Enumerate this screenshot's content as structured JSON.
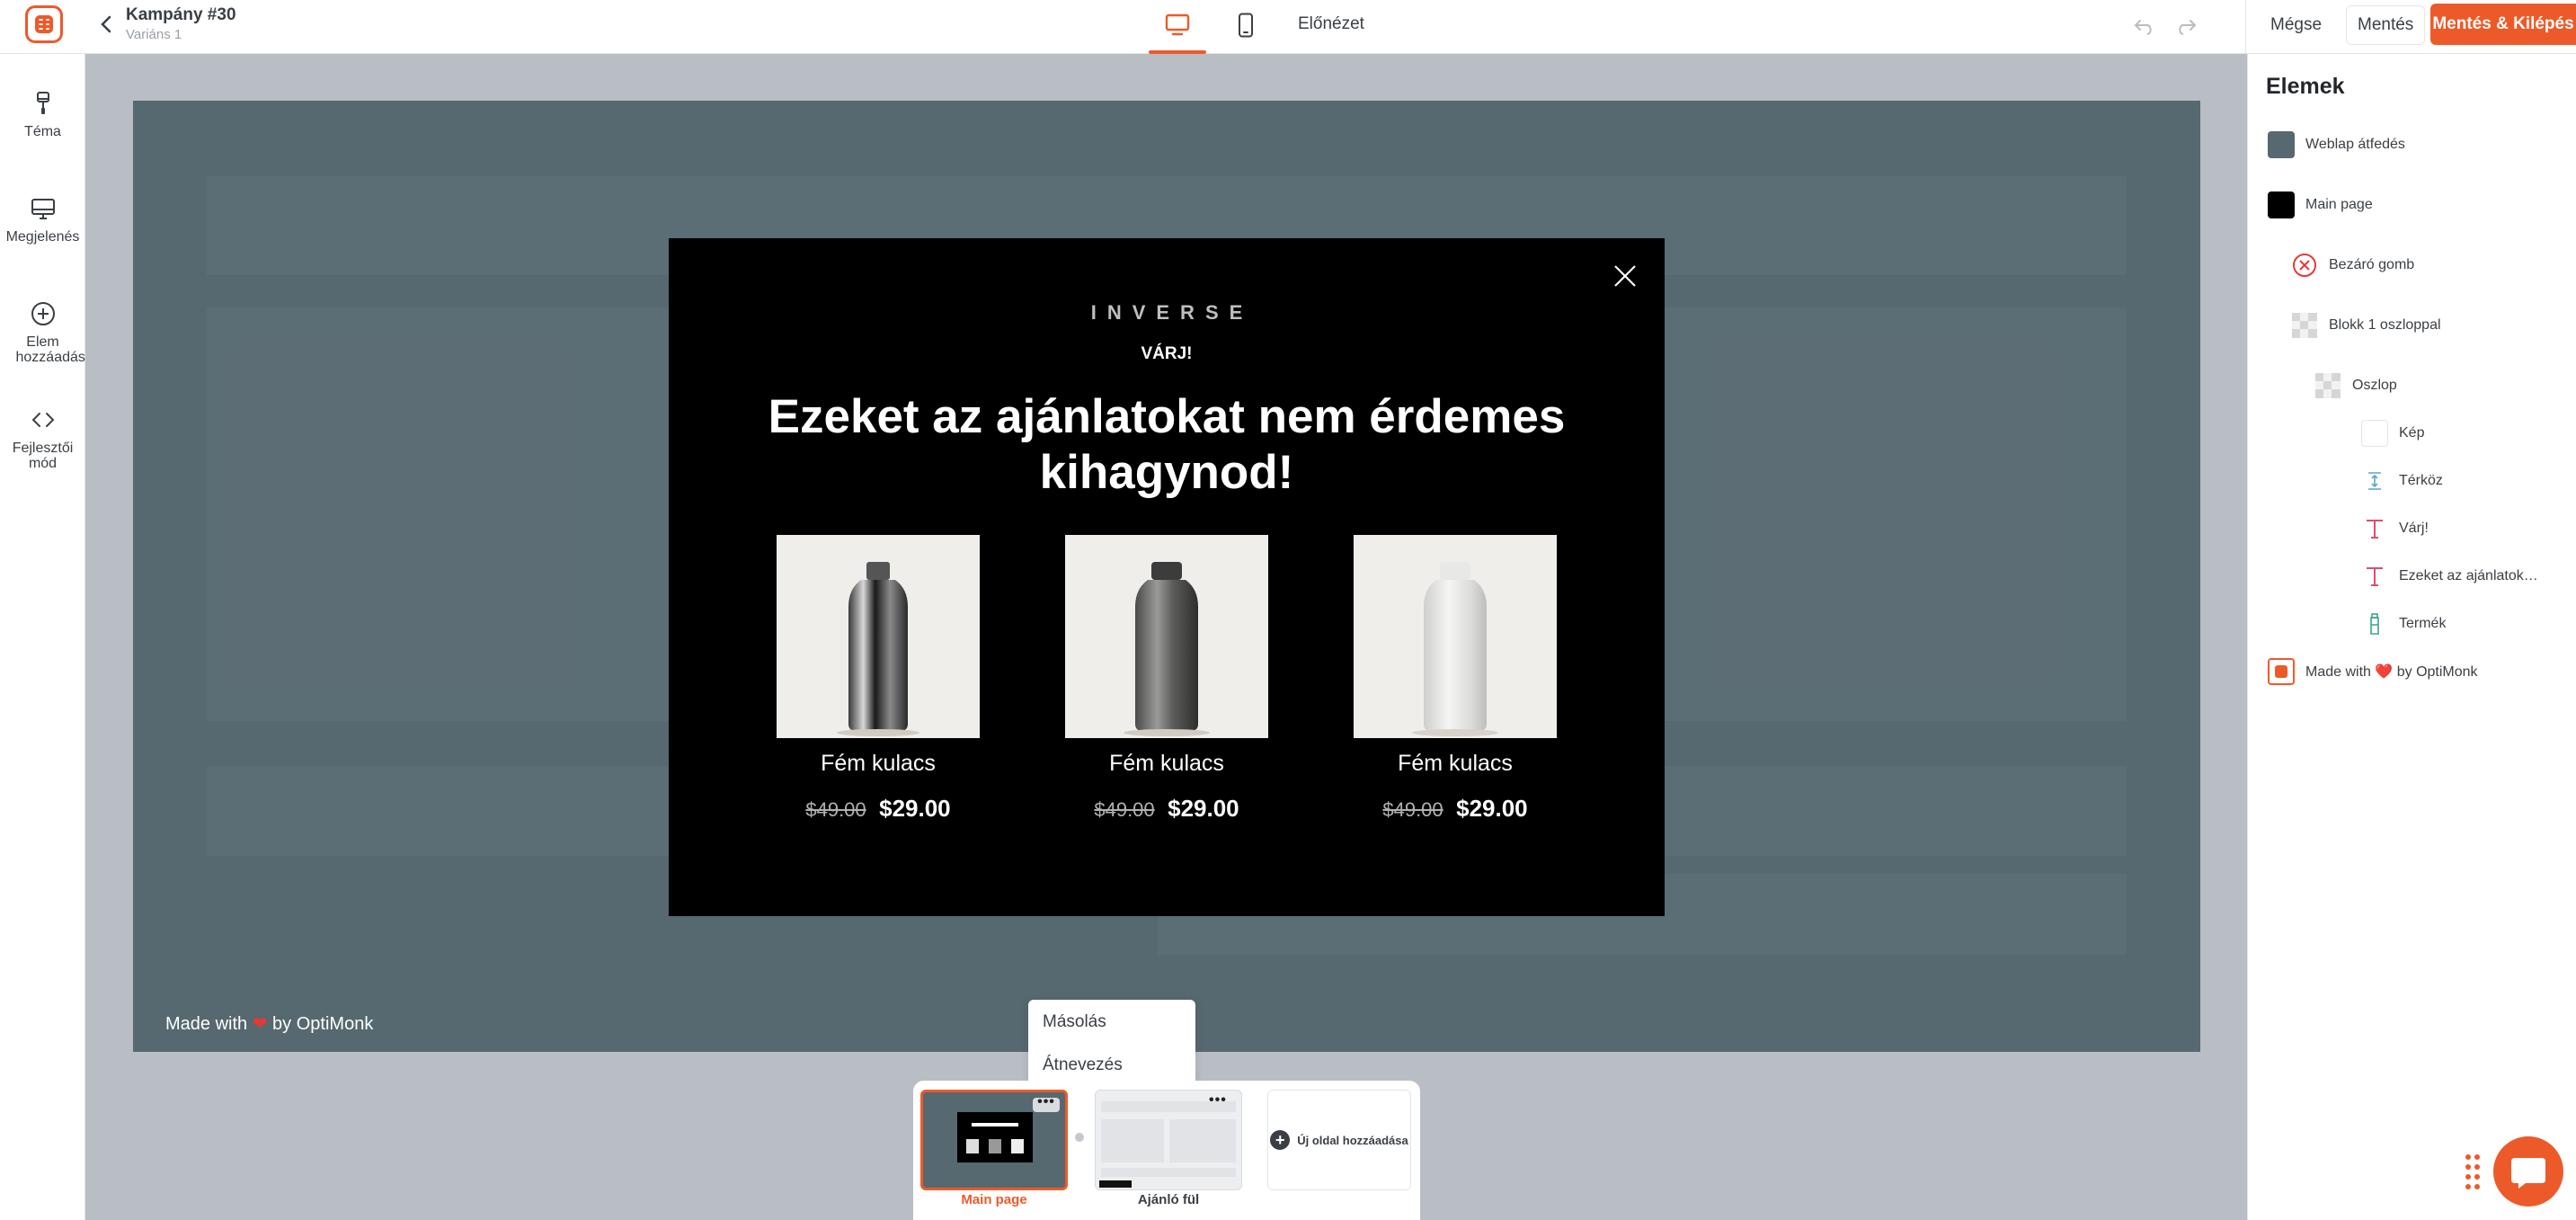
{
  "app": {
    "campaign_title": "Kampány #30",
    "variant": "Variáns 1",
    "preview": "Előnézet",
    "accent": "#ed5a29"
  },
  "actions": {
    "cancel": "Mégse",
    "save": "Mentés",
    "save_exit": "Mentés & Kilépés"
  },
  "sidebar": {
    "items": [
      {
        "label": "Téma",
        "icon": "paintbrush-icon"
      },
      {
        "label": "Megjelenés",
        "icon": "monitor-icon"
      },
      {
        "label": "Elem hozzáadás",
        "icon": "plus-circle-icon"
      },
      {
        "label": "Fejlesztői mód",
        "icon": "code-icon"
      }
    ]
  },
  "popup": {
    "brand": "INVERSE",
    "subheading": "VÁRJ!",
    "headline": "Ezeket az ajánlatokat nem érdemes kihagynod!",
    "products": [
      {
        "name": "Fém kulacs",
        "old_price": "$49.00",
        "price": "$29.00",
        "color": "dark-chrome"
      },
      {
        "name": "Fém kulacs",
        "old_price": "$49.00",
        "price": "$29.00",
        "color": "graphite"
      },
      {
        "name": "Fém kulacs",
        "old_price": "$49.00",
        "price": "$29.00",
        "color": "white"
      }
    ]
  },
  "canvas": {
    "made_with_prefix": "Made with",
    "made_with_suffix": "by OptiMonk",
    "overlay_color": "#566870"
  },
  "context_menu": {
    "items": [
      "Másolás",
      "Átnevezés"
    ]
  },
  "pages": {
    "items": [
      {
        "label": "Main page",
        "active": true
      },
      {
        "label": "Ajánló fül",
        "active": false
      }
    ],
    "add_label": "Új oldal hozzáadása"
  },
  "elements_panel": {
    "title": "Elemek",
    "items": [
      {
        "label": "Weblap átfedés",
        "icon": "overlay-swatch-icon"
      },
      {
        "label": "Main page",
        "icon": "page-swatch-icon"
      },
      {
        "label": "Bezáró gomb",
        "icon": "close-button-icon"
      },
      {
        "label": "Blokk 1 oszloppal",
        "icon": "block-icon"
      },
      {
        "label": "Oszlop",
        "icon": "column-icon"
      },
      {
        "label": "Kép",
        "icon": "image-icon"
      },
      {
        "label": "Térköz",
        "icon": "spacer-icon"
      },
      {
        "label": "Várj!",
        "icon": "text-icon"
      },
      {
        "label": "Ezeket az ajánlatoka...",
        "icon": "text-icon"
      },
      {
        "label": "Termék",
        "icon": "product-icon"
      },
      {
        "label": "Made with ❤️ by OptiMonk",
        "icon": "optimonk-icon"
      }
    ]
  }
}
